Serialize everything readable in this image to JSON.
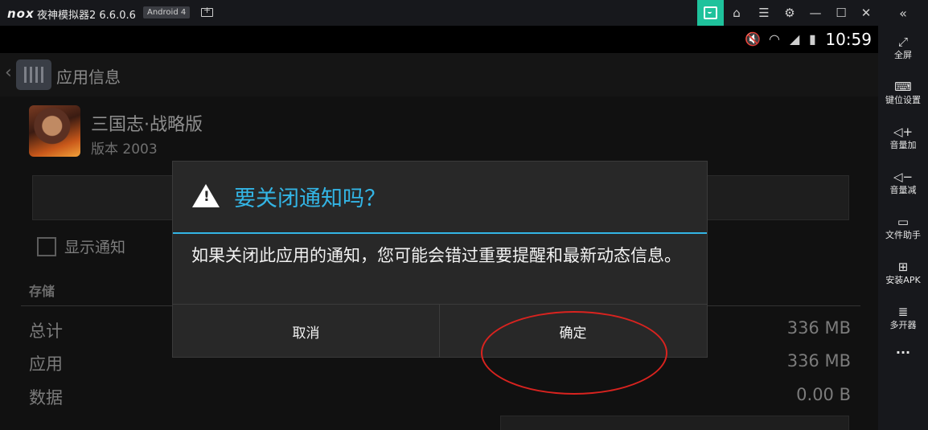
{
  "titlebar": {
    "logo": "nox",
    "title": "夜神模拟器2 6.6.0.6",
    "badge": "Android 4",
    "icons": [
      "keyboard-icon",
      "store-icon",
      "skin-icon",
      "menu-icon",
      "gear-icon",
      "minimize-icon",
      "maximize-icon",
      "close-icon",
      "collapse-sidebar-icon"
    ],
    "accent": "#1fc29c"
  },
  "sidebar": {
    "items": [
      {
        "icon": "fullscreen-icon",
        "label": "全屏"
      },
      {
        "icon": "keyboard-icon",
        "label": "键位设置"
      },
      {
        "icon": "volume-up-icon",
        "label": "音量加"
      },
      {
        "icon": "volume-down-icon",
        "label": "音量减"
      },
      {
        "icon": "file-helper-icon",
        "label": "文件助手"
      },
      {
        "icon": "apk-install-icon",
        "label": "安装APK"
      },
      {
        "icon": "multi-instance-icon",
        "label": "多开器"
      },
      {
        "icon": "more-icon",
        "label": "···"
      }
    ]
  },
  "statusbar": {
    "time": "10:59",
    "icons": [
      "mute-icon",
      "wifi-icon",
      "signal-icon",
      "battery-icon"
    ]
  },
  "appinfo": {
    "header_title": "应用信息",
    "app_name": "三国志·战略版",
    "version": "版本 2003",
    "show_notifications": "显示通知",
    "storage_heading": "存储",
    "rows": [
      {
        "label": "总计",
        "value": "336 MB"
      },
      {
        "label": "应用",
        "value": "336 MB"
      },
      {
        "label": "数据",
        "value": "0.00 B"
      }
    ]
  },
  "dialog": {
    "title": "要关闭通知吗？",
    "message": "如果关闭此应用的通知，您可能会错过重要提醒和最新动态信息。",
    "cancel": "取消",
    "ok": "确定",
    "accent": "#33b5e5",
    "annotation_color": "#d9231f"
  }
}
